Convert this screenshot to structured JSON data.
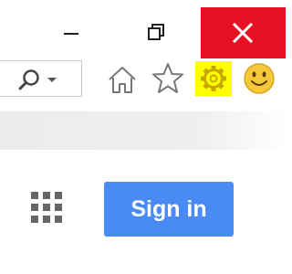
{
  "window": {
    "minimize_icon": "minimize-icon",
    "restore_icon": "restore-icon",
    "close_icon": "close-icon",
    "close_color": "#e81123"
  },
  "toolbar": {
    "search_icon": "search-icon",
    "dropdown_icon": "chevron-down-icon",
    "home_icon": "home-icon",
    "favorites_icon": "star-icon",
    "settings_icon": "gear-icon",
    "feedback_icon": "smiley-icon",
    "settings_highlight_color": "#ffff00"
  },
  "page": {
    "apps_icon": "apps-grid-icon",
    "sign_in_label": "Sign in",
    "sign_in_color": "#4a8af4"
  }
}
